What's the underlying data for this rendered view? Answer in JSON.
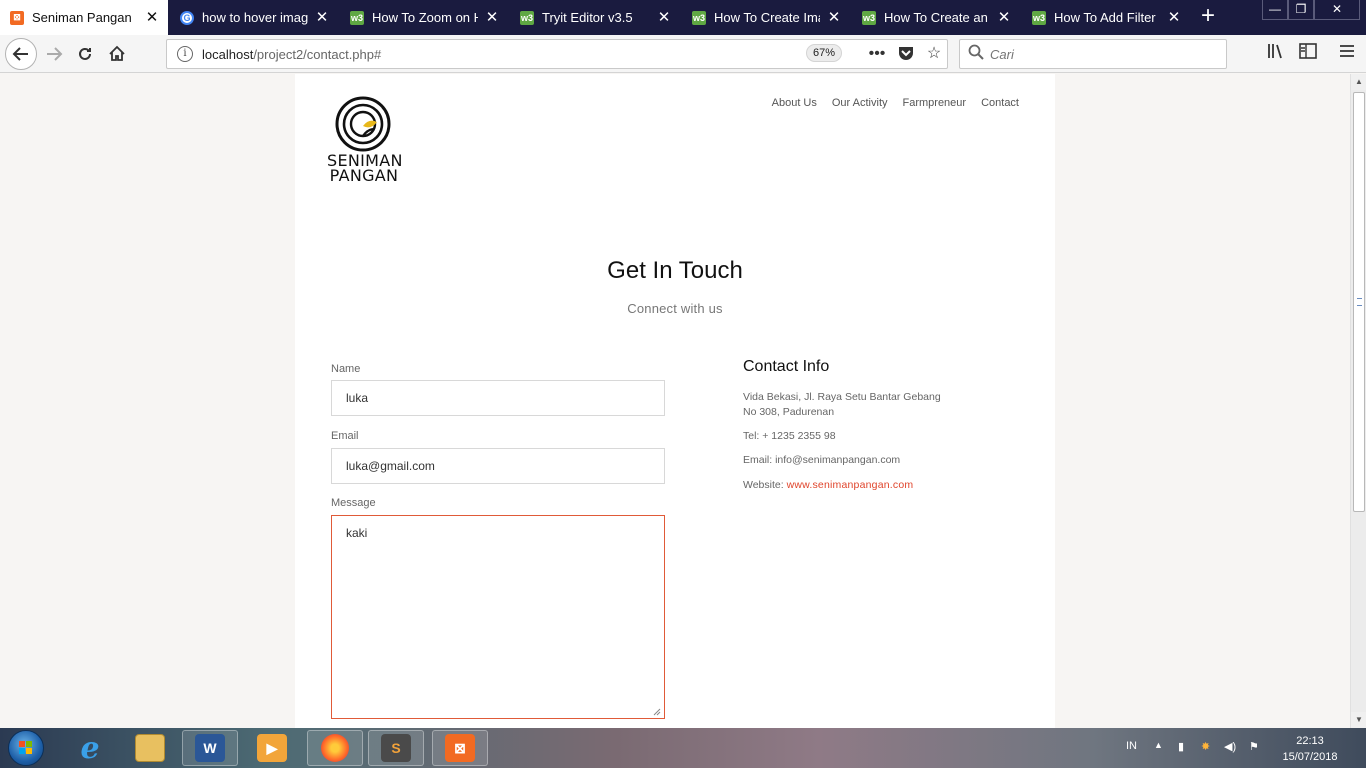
{
  "browser": {
    "tabs": [
      {
        "title": "Seniman Pangan",
        "favicon": "xampp-icon",
        "active": true
      },
      {
        "title": "how to hover image",
        "favicon": "google-icon",
        "active": false
      },
      {
        "title": "How To Zoom on Ho",
        "favicon": "w3schools-icon",
        "active": false
      },
      {
        "title": "Tryit Editor v3.5",
        "favicon": "w3schools-icon",
        "active": false
      },
      {
        "title": "How To Create Imag",
        "favicon": "w3schools-icon",
        "active": false
      },
      {
        "title": "How To Create an Im",
        "favicon": "w3schools-icon",
        "active": false
      },
      {
        "title": "How To Add Filter Ef",
        "favicon": "w3schools-icon",
        "active": false
      }
    ],
    "url_host": "localhost",
    "url_path": "/project2/contact.php#",
    "zoom": "67%",
    "search_placeholder": "Cari"
  },
  "site": {
    "logo_line1": "SENIMAN",
    "logo_line2": "PANGAN",
    "menu": [
      "About Us",
      "Our Activity",
      "Farmpreneur",
      "Contact"
    ],
    "heading": "Get In Touch",
    "subheading": "Connect with us"
  },
  "form": {
    "name_label": "Name",
    "name_value": "luka",
    "email_label": "Email",
    "email_value": "luka@gmail.com",
    "message_label": "Message",
    "message_value": "kaki"
  },
  "contact_info": {
    "title": "Contact Info",
    "address_line1": "Vida Bekasi, Jl. Raya Setu Bantar Gebang",
    "address_line2": "No 308, Padurenan",
    "tel": "Tel: + 1235 2355 98",
    "email": "Email: info@senimanpangan.com",
    "website_label": "Website: ",
    "website_link": "www.senimanpangan.com"
  },
  "taskbar": {
    "language": "IN",
    "time": "22:13",
    "date": "15/07/2018"
  },
  "colors": {
    "accent": "#e0452c",
    "tabbar": "#1a1b3f"
  }
}
